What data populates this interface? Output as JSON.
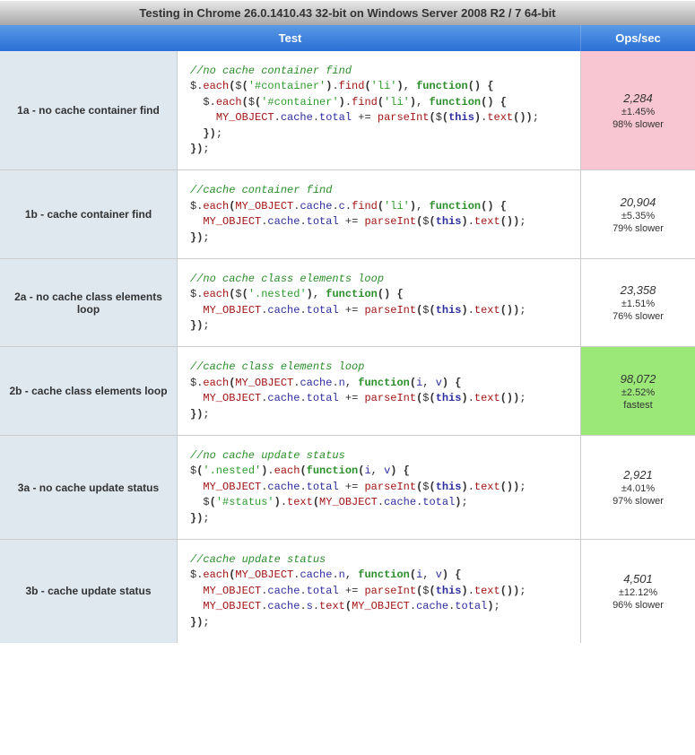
{
  "banner": "Testing in Chrome 26.0.1410.43 32-bit on Windows Server 2008 R2 / 7 64-bit",
  "headers": {
    "test": "Test",
    "ops": "Ops/sec"
  },
  "tests": [
    {
      "label": "1a - no cache container find",
      "code": "//no cache container find\n$.each($('#container').find('li'), function() {\n  $.each($('#container').find('li'), function() {\n    MY_OBJECT.cache.total += parseInt($(this).text());\n  });\n});",
      "ops": "2,284",
      "err": "±1.45%",
      "rank": "98% slower",
      "rankClass": "slowest"
    },
    {
      "label": "1b - cache container find",
      "code": "//cache container find\n$.each(MY_OBJECT.cache.c.find('li'), function() {\n  MY_OBJECT.cache.total += parseInt($(this).text());\n});",
      "ops": "20,904",
      "err": "±5.35%",
      "rank": "79% slower",
      "rankClass": ""
    },
    {
      "label": "2a - no cache class elements loop",
      "code": "//no cache class elements loop\n$.each($('.nested'), function() {\n  MY_OBJECT.cache.total += parseInt($(this).text());\n});",
      "ops": "23,358",
      "err": "±1.51%",
      "rank": "76% slower",
      "rankClass": ""
    },
    {
      "label": "2b - cache class elements loop",
      "code": "//cache class elements loop\n$.each(MY_OBJECT.cache.n, function(i, v) {\n  MY_OBJECT.cache.total += parseInt($(this).text());\n});",
      "ops": "98,072",
      "err": "±2.52%",
      "rank": "fastest",
      "rankClass": "fastest"
    },
    {
      "label": "3a - no cache update status",
      "code": "//no cache update status\n$('.nested').each(function(i, v) {\n  MY_OBJECT.cache.total += parseInt($(this).text());\n  $('#status').text(MY_OBJECT.cache.total);\n});",
      "ops": "2,921",
      "err": "±4.01%",
      "rank": "97% slower",
      "rankClass": ""
    },
    {
      "label": "3b - cache update status",
      "code": "//cache update status\n$.each(MY_OBJECT.cache.n, function(i, v) {\n  MY_OBJECT.cache.total += parseInt($(this).text());\n  MY_OBJECT.cache.s.text(MY_OBJECT.cache.total);\n});",
      "ops": "4,501",
      "err": "±12.12%",
      "rank": "96% slower",
      "rankClass": ""
    }
  ]
}
